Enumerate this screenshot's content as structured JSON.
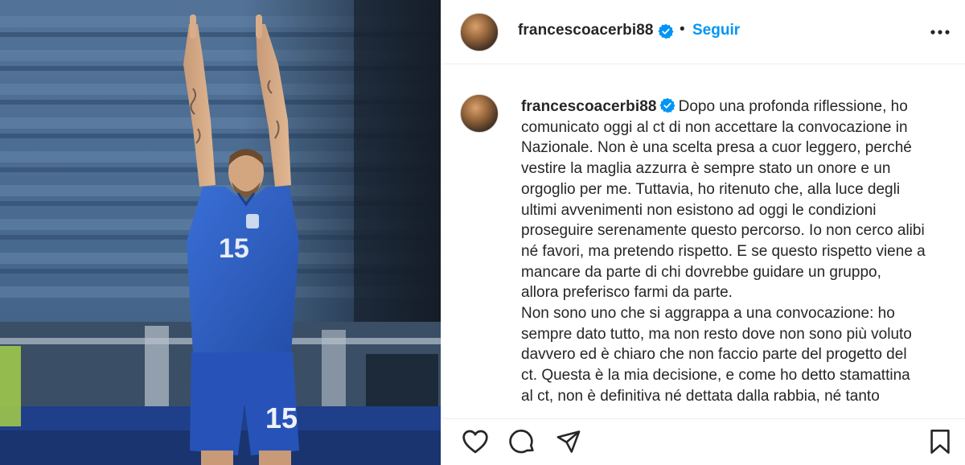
{
  "post": {
    "author": "francescoacerbi88",
    "follow_label": "Seguir",
    "separator": "•",
    "caption_lines": [
      "Dopo una profonda riflessione, ho",
      "comunicato oggi al ct di non accettare la convocazione in",
      "Nazionale. Non è una scelta presa a cuor leggero, perché",
      "vestire la maglia azzurra è sempre stato un onore e un",
      "orgoglio per me. Tuttavia, ho ritenuto che, alla luce degli",
      "ultimi avvenimenti non esistono ad oggi le condizioni",
      "proseguire serenamente questo percorso. Io non cerco alibi",
      "né favori, ma pretendo rispetto. E se questo rispetto viene a",
      "mancare da parte di chi dovrebbe guidare un gruppo,",
      "allora preferisco farmi da parte.",
      "Non sono uno che si aggrappa a una convocazione: ho",
      "sempre dato tutto, ma non resto dove non sono più voluto",
      "davvero ed è chiaro che non faccio parte del progetto del",
      "ct. Questa è la mia decisione, e come ho detto stamattina",
      "al ct, non è definitiva né dettata dalla rabbia, né tanto"
    ],
    "jersey_number": "15"
  },
  "icons": {
    "verified": "verified-badge-icon",
    "more": "more-options-icon",
    "like": "heart-icon",
    "comment": "comment-icon",
    "share": "send-icon",
    "save": "bookmark-icon"
  },
  "colors": {
    "follow": "#0095f6",
    "verified": "#0095f6",
    "text": "#262626",
    "jersey": "#2f5fc4"
  }
}
